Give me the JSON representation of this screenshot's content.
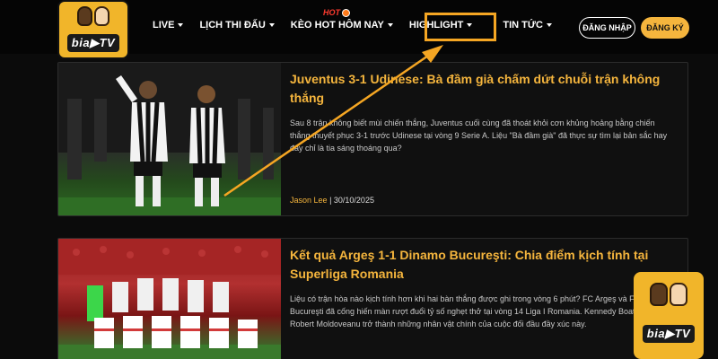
{
  "logo": {
    "text": "bia▶TV"
  },
  "nav": {
    "items": [
      {
        "label": "LIVE"
      },
      {
        "label": "LỊCH THI ĐẤU"
      },
      {
        "label": "KÈO HOT HÔM NAY"
      },
      {
        "label": "HIGHLIGHT"
      },
      {
        "label": "TIN TỨC"
      }
    ],
    "hot_badge": "HOT"
  },
  "auth": {
    "login_label": "ĐĂNG NHẬP",
    "register_label": "ĐĂNG KÝ"
  },
  "articles": [
    {
      "title": "Juventus 3-1 Udinese: Bà đầm già chấm dứt chuỗi trận không thắng",
      "summary": "Sau 8 trận không biết mùi chiến thắng, Juventus cuối cùng đã thoát khỏi cơn khủng hoảng bằng chiến thắng thuyết phục 3-1 trước Udinese tại vòng 9 Serie A. Liệu \"Bà đầm già\" đã thực sự tìm lại bản sắc hay đây chỉ là tia sáng thoáng qua?",
      "author": "Jason Lee",
      "date": "30/10/2025"
    },
    {
      "title": "Kết quả Argeş 1-1 Dinamo Bucureşti: Chia điểm kịch tính tại Superliga Romania",
      "summary": "Liệu có trận hòa nào kịch tính hơn khi hai bàn thắng được ghi trong vòng 6 phút? FC Argeş và FC Dinamo Bucureşti đã cống hiến màn rượt đuổi tỷ số nghẹt thở tại vòng 14 Liga I Romania. Kennedy Boateng và Robert Moldoveanu trở thành những nhân vật chính của cuộc đối đầu đầy xúc này."
    }
  ],
  "colors": {
    "accent": "#f5b53d",
    "highlight_border": "#f5a623",
    "background": "#0b0b0b"
  }
}
